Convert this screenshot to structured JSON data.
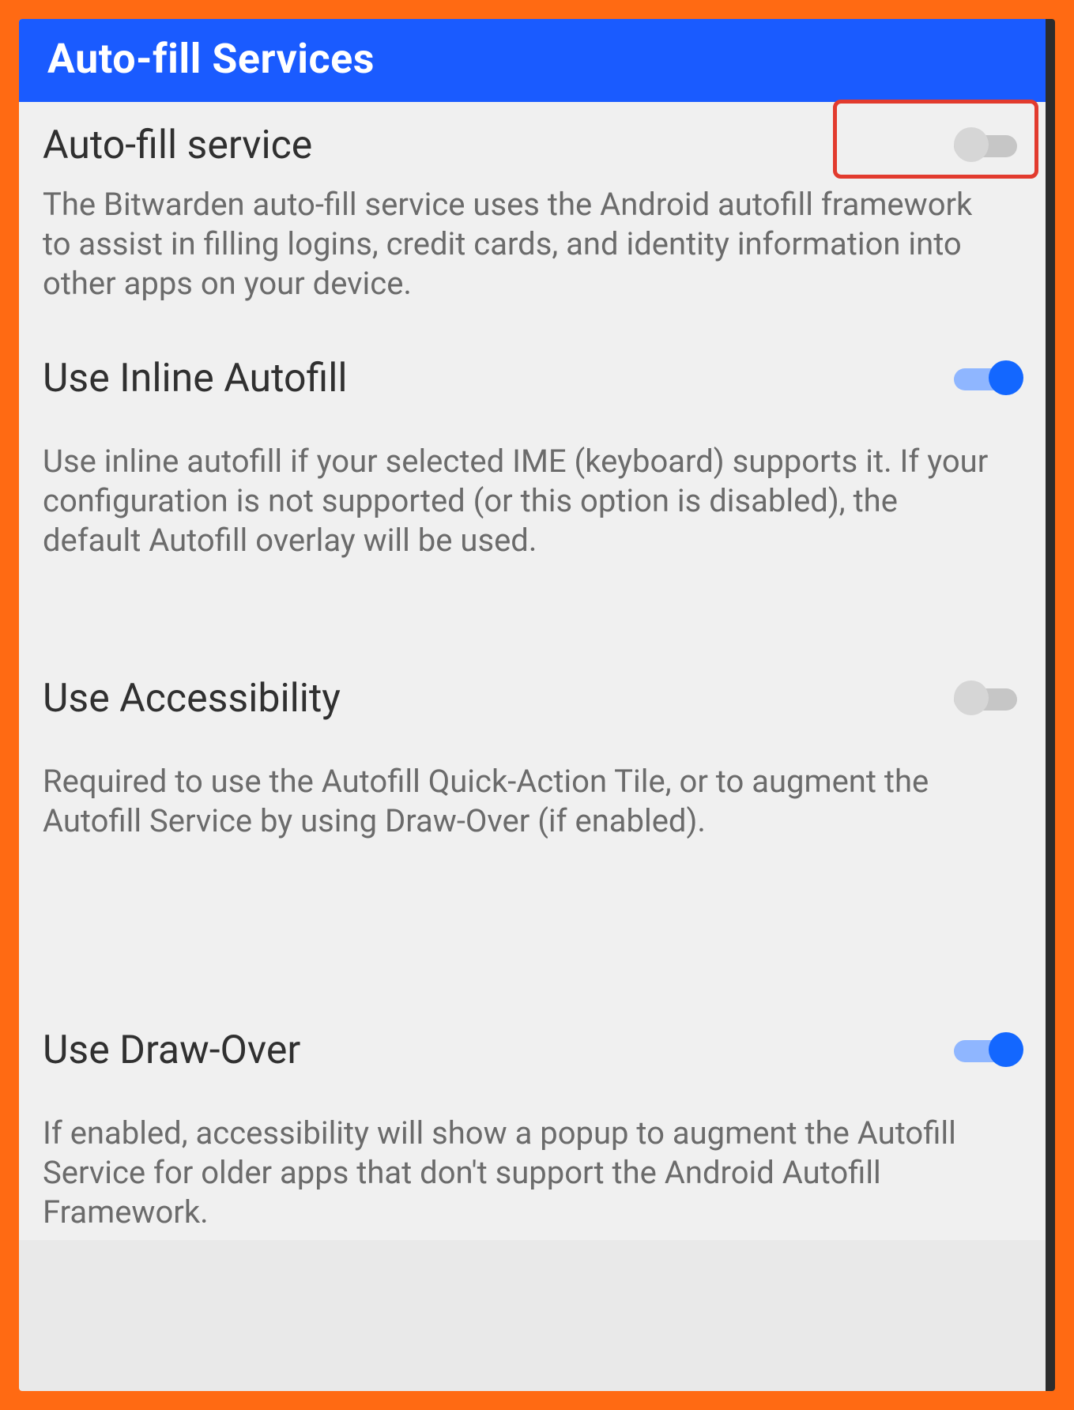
{
  "header": {
    "title": "Auto-fill Services"
  },
  "settings": {
    "autofill_service": {
      "title": "Auto-fill service",
      "desc": "The Bitwarden auto-fill service uses the Android autofill framework to assist in filling logins, credit cards, and identity information into other apps on your device.",
      "enabled": false
    },
    "inline_autofill": {
      "title": "Use Inline Autofill",
      "desc": "Use inline autofill if your selected IME (keyboard) supports it. If your configuration is not supported (or this option is disabled), the default Autofill overlay will be used.",
      "enabled": true
    },
    "accessibility": {
      "title": "Use Accessibility",
      "desc": "Required to use the Autofill Quick-Action Tile, or to augment the Autofill Service by using Draw-Over (if enabled).",
      "enabled": false
    },
    "draw_over": {
      "title": "Use Draw-Over",
      "desc": "If enabled, accessibility will show a popup to augment the Autofill Service for older apps that don't support the Android Autofill Framework.",
      "enabled": true
    }
  },
  "callout": {
    "target": "autofill-service-toggle"
  }
}
